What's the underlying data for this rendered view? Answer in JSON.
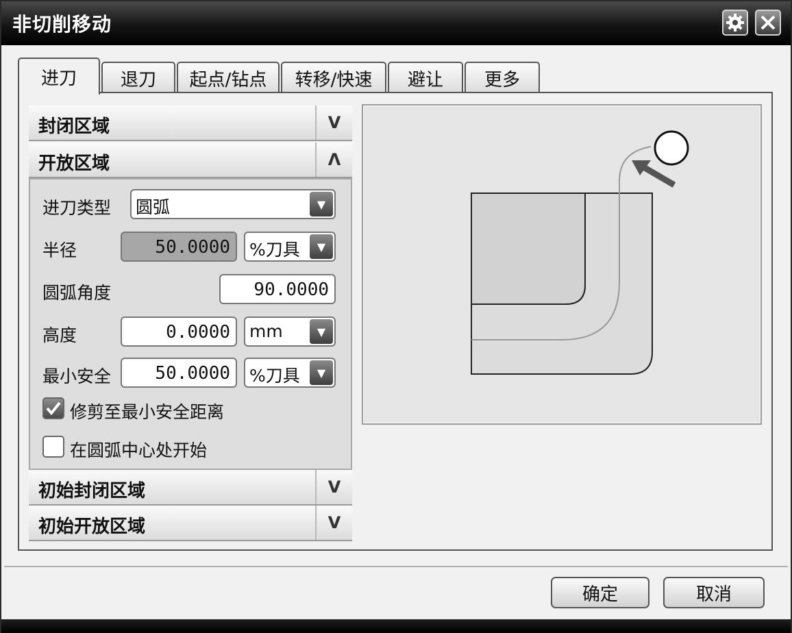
{
  "window": {
    "title": "非切削移动"
  },
  "titlebar": {
    "settings_icon": "gear-icon",
    "close_icon": "close-icon"
  },
  "tabs": [
    {
      "label": "进刀",
      "active": true
    },
    {
      "label": "退刀"
    },
    {
      "label": "起点/钻点"
    },
    {
      "label": "转移/快速"
    },
    {
      "label": "避让"
    },
    {
      "label": "更多"
    }
  ],
  "sections": {
    "closed_area": {
      "label": "封闭区域",
      "chevron": "V"
    },
    "open_area": {
      "label": "开放区域",
      "chevron": "Λ"
    },
    "initial_closed_area": {
      "label": "初始封闭区域",
      "chevron": "V"
    },
    "initial_open_area": {
      "label": "初始开放区域",
      "chevron": "V"
    }
  },
  "open_area": {
    "engage_type": {
      "label": "进刀类型",
      "value": "圆弧"
    },
    "radius": {
      "label": "半径",
      "value": "50.0000",
      "unit": "%刀具"
    },
    "arc_angle": {
      "label": "圆弧角度",
      "value": "90.0000"
    },
    "height": {
      "label": "高度",
      "value": "0.0000",
      "unit": "mm"
    },
    "min_clearance": {
      "label": "最小安全",
      "value": "50.0000",
      "unit": "%刀具"
    },
    "trim_checkbox": {
      "label": "修剪至最小安全距离",
      "checked": true
    },
    "start_at_center_checkbox": {
      "label": "在圆弧中心处开始",
      "checked": false
    }
  },
  "footer": {
    "ok_label": "确定",
    "cancel_label": "取消"
  }
}
